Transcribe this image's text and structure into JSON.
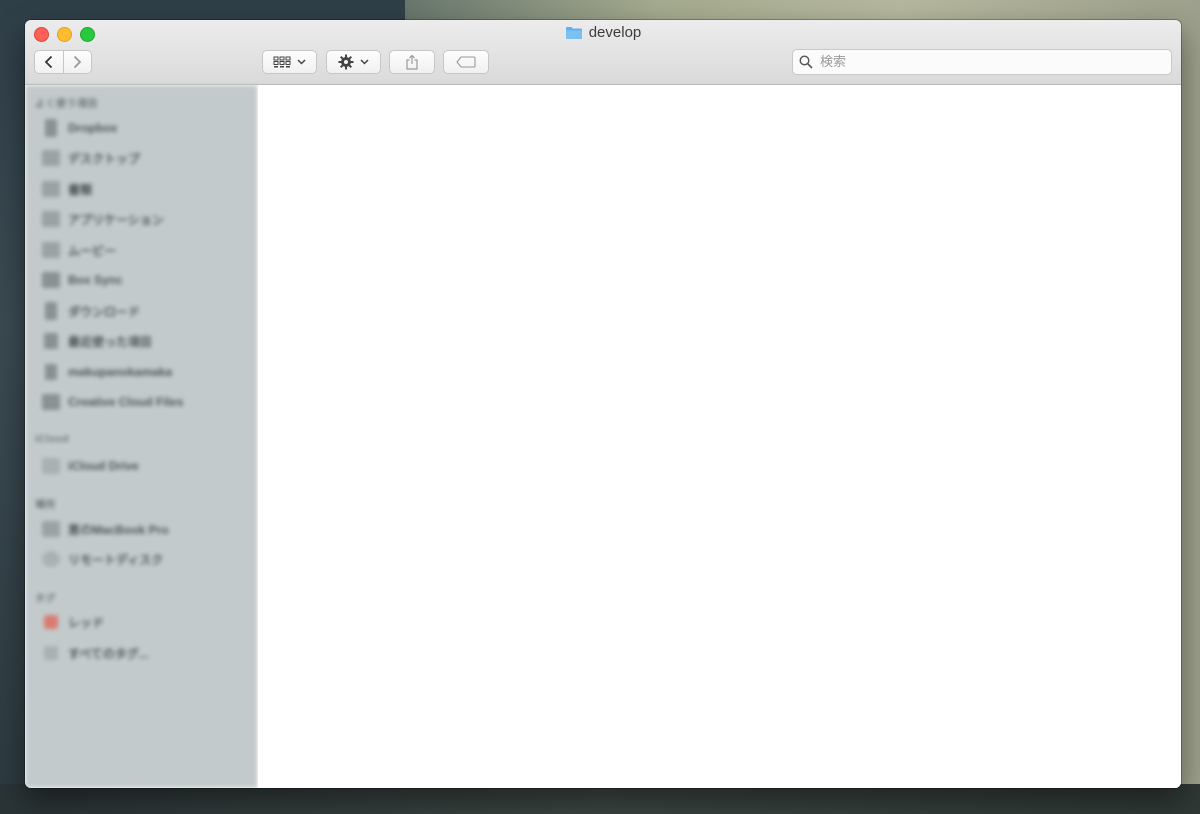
{
  "window": {
    "title": "develop",
    "folder_color": "#5aa9e6"
  },
  "toolbar": {
    "back_icon": "chevron-left-icon",
    "forward_icon": "chevron-right-icon",
    "view_icon": "grid-view-icon",
    "action_icon": "gear-icon",
    "share_icon": "share-icon",
    "tag_icon": "tag-icon",
    "search": {
      "placeholder": "検索",
      "value": ""
    }
  },
  "sidebar": {
    "sections": [
      {
        "header": "よく使う項目",
        "items": [
          {
            "label": "Dropbox",
            "icon": "dropbox-icon"
          },
          {
            "label": "デスクトップ",
            "icon": "desktop-icon"
          },
          {
            "label": "書類",
            "icon": "documents-icon"
          },
          {
            "label": "アプリケーション",
            "icon": "applications-icon"
          },
          {
            "label": "ムービー",
            "icon": "movies-icon"
          },
          {
            "label": "Box Sync",
            "icon": "box-sync-icon"
          },
          {
            "label": "ダウンロード",
            "icon": "downloads-icon"
          },
          {
            "label": "最近使った項目",
            "icon": "recents-icon"
          },
          {
            "label": "makupanokamaka",
            "icon": "home-icon"
          },
          {
            "label": "Creative Cloud Files",
            "icon": "creative-cloud-icon"
          }
        ]
      },
      {
        "header": "iCloud",
        "items": [
          {
            "label": "iCloud Drive",
            "icon": "icloud-icon"
          }
        ]
      },
      {
        "header": "場所",
        "items": [
          {
            "label": "恵のMacBook Pro",
            "icon": "laptop-icon"
          },
          {
            "label": "リモートディスク",
            "icon": "remote-disc-icon"
          }
        ]
      },
      {
        "header": "タグ",
        "items": [
          {
            "label": "レッド",
            "icon": "red-tag-icon"
          },
          {
            "label": "すべてのタグ...",
            "icon": "all-tags-icon"
          }
        ]
      }
    ]
  }
}
